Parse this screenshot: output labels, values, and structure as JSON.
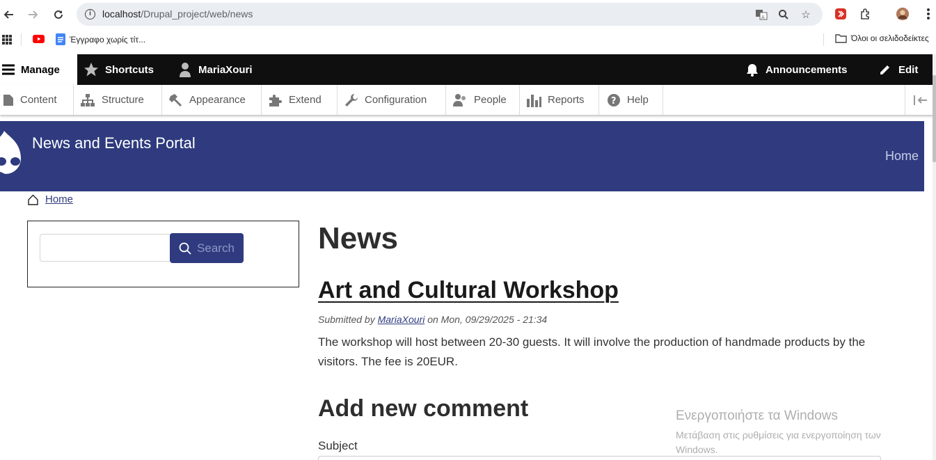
{
  "browser": {
    "url_host": "localhost",
    "url_path": "/Drupal_project/web/news",
    "bookmarks": {
      "doc_label": "Έγγραφο χωρίς τίτ...",
      "folder_label": "Όλοι οι σελιδοδείκτες"
    }
  },
  "toolbar": {
    "manage": "Manage",
    "shortcuts": "Shortcuts",
    "user": "MariaXouri",
    "announcements": "Announcements",
    "edit": "Edit"
  },
  "admin_menu": [
    {
      "label": "Content",
      "icon": "content-icon"
    },
    {
      "label": "Structure",
      "icon": "structure-icon"
    },
    {
      "label": "Appearance",
      "icon": "appearance-icon"
    },
    {
      "label": "Extend",
      "icon": "extend-icon"
    },
    {
      "label": "Configuration",
      "icon": "configuration-icon"
    },
    {
      "label": "People",
      "icon": "people-icon"
    },
    {
      "label": "Reports",
      "icon": "reports-icon"
    },
    {
      "label": "Help",
      "icon": "help-icon"
    }
  ],
  "site": {
    "name": "News and Events Portal",
    "nav_home": "Home",
    "header_color": "#2f3b7e"
  },
  "breadcrumb": {
    "home": "Home"
  },
  "search": {
    "button": "Search",
    "value": ""
  },
  "page": {
    "title": "News",
    "article": {
      "title": "Art and Cultural Workshop",
      "submitted_prefix": "Submitted by",
      "author": "MariaXouri",
      "date": "on Mon, 09/29/2025 - 21:34",
      "body": "The workshop will host between 20-30 guests. It will involve the production of handmade products by the visitors. The fee is 20EUR."
    },
    "comment": {
      "title": "Add new comment",
      "subject_label": "Subject"
    }
  },
  "watermark": {
    "title": "Ενεργοποιήστε τα Windows",
    "subtitle": "Μετάβαση στις ρυθμίσεις για ενεργοποίηση των Windows."
  }
}
